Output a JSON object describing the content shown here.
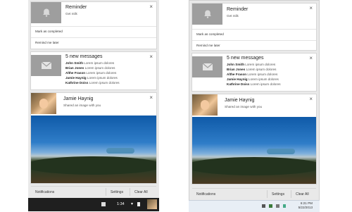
{
  "reminder": {
    "title": "Reminder",
    "subtitle": "Get milk",
    "icon": "bell-icon",
    "close_label": "×",
    "actions": [
      "Mark as completed",
      "Remind me later"
    ]
  },
  "messages": {
    "title": "5 new messages",
    "icon": "envelope-icon",
    "close_label": "×",
    "items": [
      {
        "sender": "John Smith",
        "text": "Lorem ipsum dolores"
      },
      {
        "sender": "Brian Jones",
        "text": "Lorem ipsum dolores"
      },
      {
        "sender": "Althe Frason",
        "text": "Lorem ipsum dolores"
      },
      {
        "sender": "Jamie Haynig",
        "text": "Lorem ipsum dolores"
      },
      {
        "sender": "Kathrine Doiss",
        "text": "Lorem ipsum dolores"
      }
    ]
  },
  "share": {
    "title": "Jamie Haynig",
    "subtitle": "Shared an image with you",
    "close_label": "×"
  },
  "footer": {
    "notifications_label": "Notifications",
    "settings_label": "Settings",
    "clear_all_label": "Clear All"
  },
  "taskbar_left": {
    "time": "1:34"
  },
  "taskbar_right": {
    "time": "6:21 PM",
    "date": "5/22/2013"
  },
  "colors": {
    "panel_bg": "#e9e9e9",
    "icon_box": "#9e9e9e",
    "chrome_taskbar": "#1f1f1f"
  }
}
